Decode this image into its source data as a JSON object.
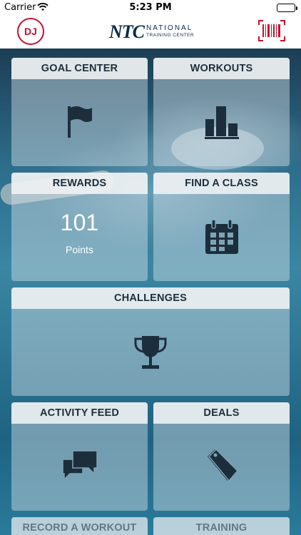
{
  "status_bar": {
    "carrier": "Carrier",
    "time": "5:23 PM"
  },
  "header": {
    "avatar_initials": "DJ",
    "logo_mark": "NTC",
    "logo_line1": "NATIONAL",
    "logo_line2": "TRAINING CENTER",
    "barcode_icon": "barcode-icon",
    "accent_color": "#c8102e"
  },
  "tiles": {
    "goal_center": {
      "label": "GOAL CENTER",
      "icon": "flag-icon"
    },
    "workouts": {
      "label": "WORKOUTS",
      "icon": "bar-chart-icon"
    },
    "rewards": {
      "label": "REWARDS",
      "value": "101",
      "unit": "Points"
    },
    "find_class": {
      "label": "FIND A CLASS",
      "icon": "calendar-icon"
    },
    "challenges": {
      "label": "CHALLENGES",
      "icon": "trophy-icon"
    },
    "activity_feed": {
      "label": "ACTIVITY FEED",
      "icon": "chat-icon"
    },
    "deals": {
      "label": "DEALS",
      "icon": "tag-icon"
    },
    "record_workout": {
      "label": "RECORD A WORKOUT"
    },
    "training": {
      "label": "TRAINING"
    }
  },
  "colors": {
    "icon": "#1c2e3c",
    "brand": "#0b2a4a"
  }
}
